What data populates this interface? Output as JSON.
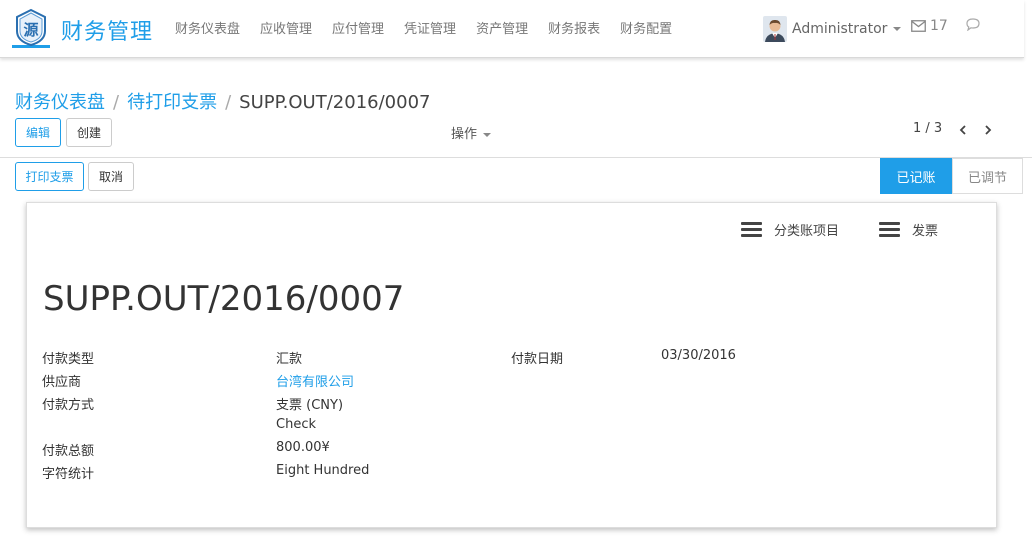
{
  "navbar": {
    "logo_text": "源",
    "app_title": "财务管理",
    "menu": [
      "财务仪表盘",
      "应收管理",
      "应付管理",
      "凭证管理",
      "资产管理",
      "财务报表",
      "财务配置"
    ],
    "user": "Administrator",
    "mail_count": "17",
    "accent_color": "#1f9ee8"
  },
  "breadcrumb": {
    "items": [
      "财务仪表盘",
      "待打印支票"
    ],
    "current": "SUPP.OUT/2016/0007"
  },
  "toolbar": {
    "edit_label": "编辑",
    "create_label": "创建",
    "actions_label": "操作",
    "pager": "1 / 3"
  },
  "header_buttons": {
    "print_check": "打印支票",
    "cancel": "取消"
  },
  "statusbar": {
    "active": "已记账",
    "idle": "已调节"
  },
  "sheet": {
    "smart_buttons": [
      "分类账项目",
      "发票"
    ],
    "title": "SUPP.OUT/2016/0007",
    "fields": {
      "payment_type_label": "付款类型",
      "payment_type": "汇款",
      "partner_label": "供应商",
      "partner": "台湾有限公司",
      "journal_label": "付款方式",
      "journal": "支票 (CNY)",
      "method": "Check",
      "amount_label": "付款总额",
      "amount": "800.00¥",
      "words_label": "字符统计",
      "words": "Eight Hundred",
      "date_label": "付款日期",
      "date": "03/30/2016"
    }
  }
}
